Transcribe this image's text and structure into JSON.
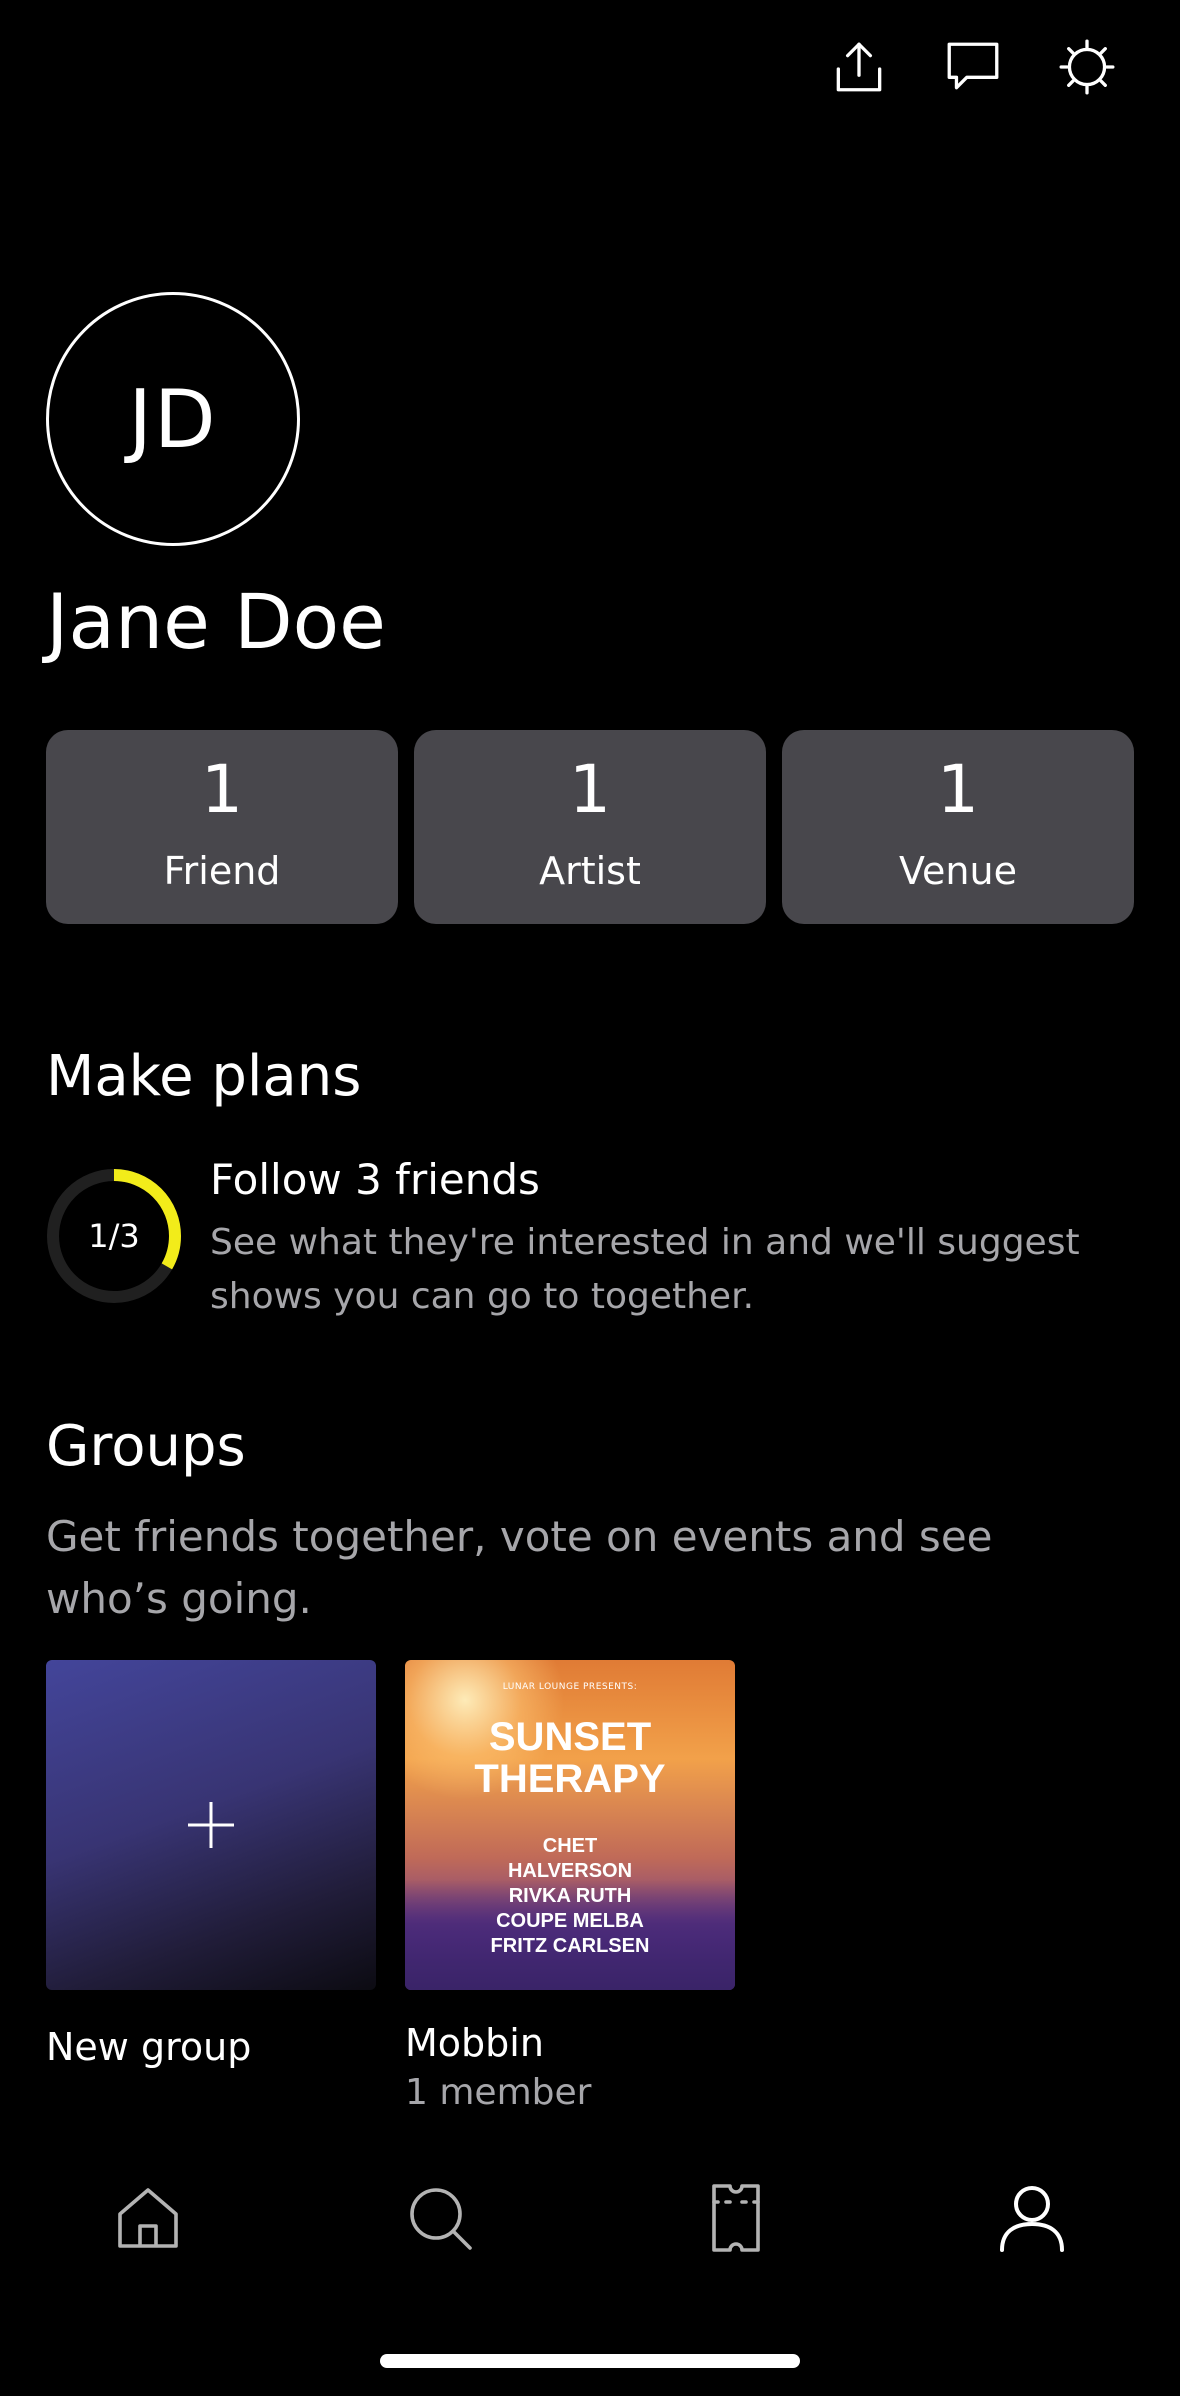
{
  "toolbar": {
    "share_icon": "share-icon",
    "messages_icon": "chat-bubble-icon",
    "settings_icon": "gear-icon"
  },
  "profile": {
    "initials": "JD",
    "name": "Jane Doe"
  },
  "stats": [
    {
      "count": "1",
      "label": "Friend"
    },
    {
      "count": "1",
      "label": "Artist"
    },
    {
      "count": "1",
      "label": "Venue"
    }
  ],
  "make_plans": {
    "title": "Make plans",
    "progress_text": "1/3",
    "progress_fraction": 0.333,
    "progress_color": "#f2ec1a",
    "task_title": "Follow 3 friends",
    "task_description": "See what they're interested in and we'll suggest shows you can go to together."
  },
  "groups": {
    "title": "Groups",
    "description": "Get friends together, vote on events and see who’s going.",
    "new_group_label": "New group",
    "items": [
      {
        "name": "Mobbin",
        "members": "1 member",
        "poster": {
          "presenter": "LUNAR LOUNGE PRESENTS:",
          "title_line1": "SUNSET",
          "title_line2": "THERAPY",
          "lineup": [
            "CHET",
            "HALVERSON",
            "RIVKA RUTH",
            "COUPE MELBA",
            "FRITZ CARLSEN"
          ]
        }
      }
    ]
  },
  "nav": {
    "items": [
      "home-icon",
      "search-icon",
      "tickets-icon",
      "profile-icon"
    ],
    "active": "profile-icon"
  },
  "colors": {
    "background": "#000000",
    "card": "#48474c",
    "secondary_text": "#a6a6aa",
    "accent_yellow": "#f2ec1a",
    "inactive_nav": "#b3b3b3"
  }
}
